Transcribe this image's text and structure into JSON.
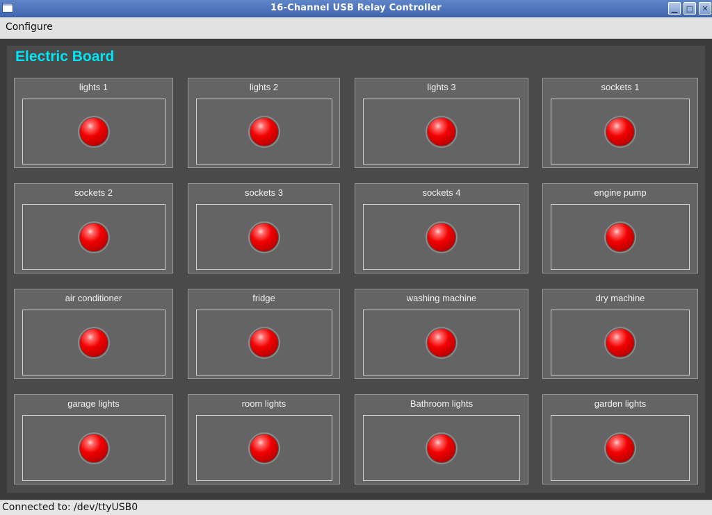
{
  "window": {
    "title": "16-Channel USB Relay Controller"
  },
  "menu": {
    "configure_label": "Configure"
  },
  "board": {
    "title": "Electric Board"
  },
  "relays": [
    {
      "label": "lights 1",
      "state": "off"
    },
    {
      "label": "lights 2",
      "state": "off"
    },
    {
      "label": "lights 3",
      "state": "off"
    },
    {
      "label": "sockets 1",
      "state": "off"
    },
    {
      "label": "sockets 2",
      "state": "off"
    },
    {
      "label": "sockets 3",
      "state": "off"
    },
    {
      "label": "sockets 4",
      "state": "off"
    },
    {
      "label": "engine pump",
      "state": "off"
    },
    {
      "label": "air conditioner",
      "state": "off"
    },
    {
      "label": "fridge",
      "state": "off"
    },
    {
      "label": "washing machine",
      "state": "off"
    },
    {
      "label": "dry machine",
      "state": "off"
    },
    {
      "label": "garage lights",
      "state": "off"
    },
    {
      "label": "room lights",
      "state": "off"
    },
    {
      "label": "Bathroom lights",
      "state": "off"
    },
    {
      "label": "garden lights",
      "state": "off"
    }
  ],
  "status": {
    "text": "Connected to: /dev/ttyUSB0"
  },
  "colors": {
    "title_accent": "#00e5f5",
    "led_off": "#e00000",
    "titlebar": "#4a72bc"
  }
}
